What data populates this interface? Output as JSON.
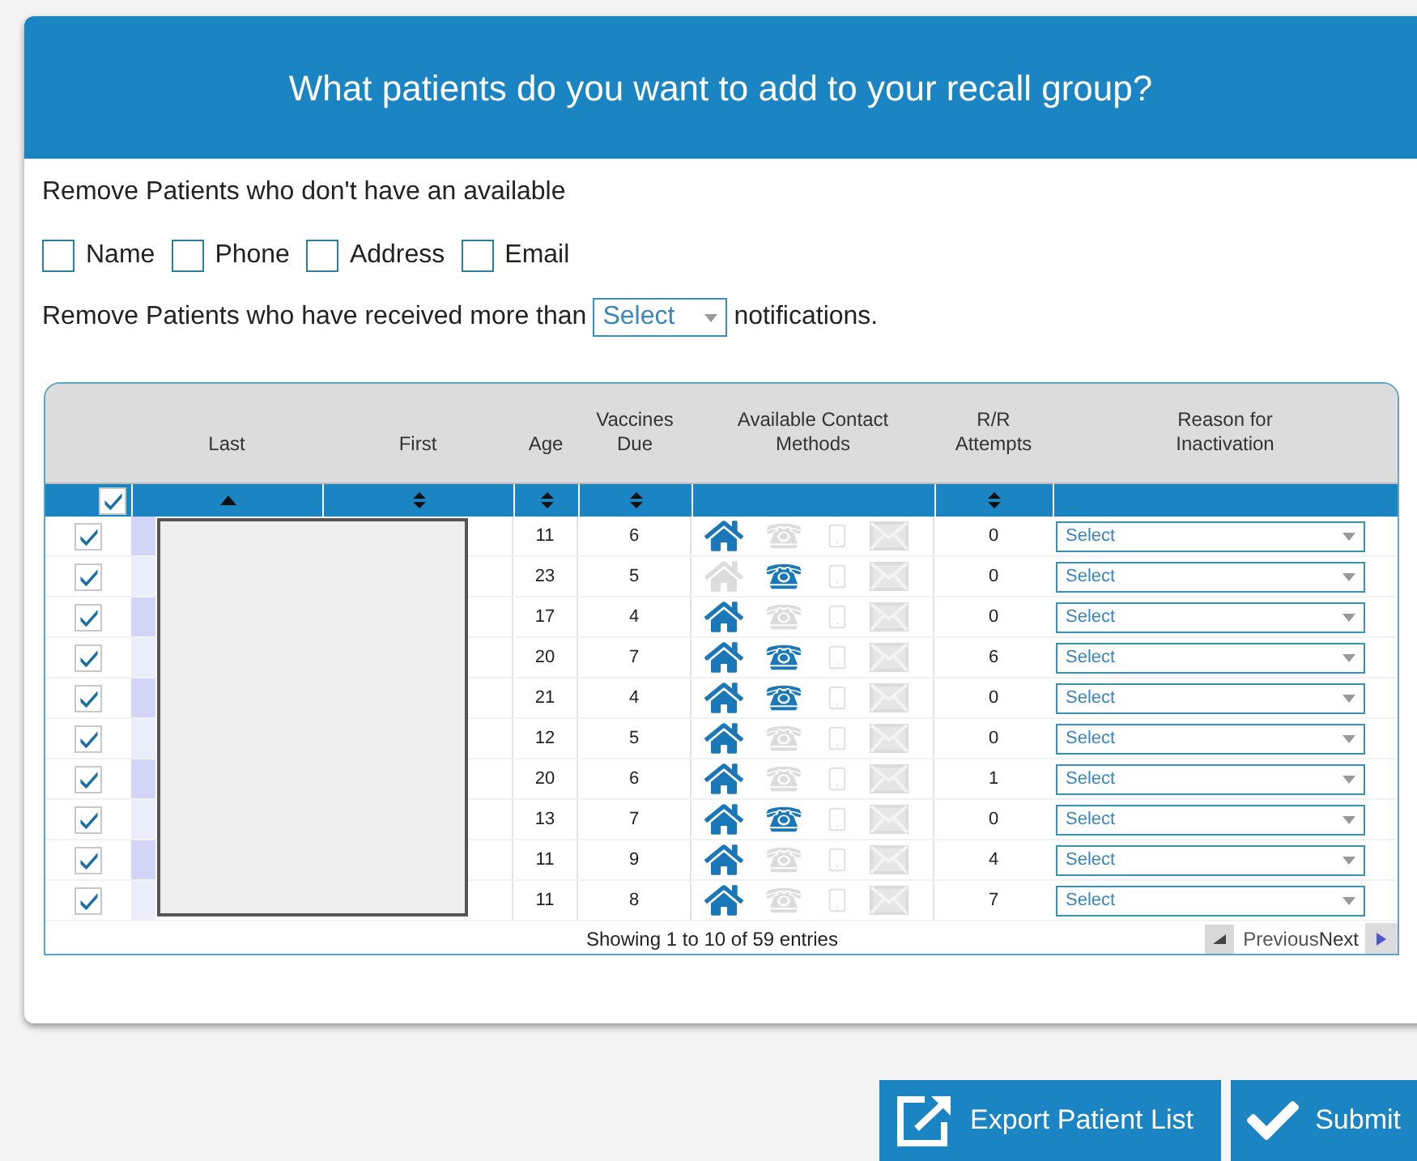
{
  "header": {
    "title": "What patients do you want to add to your recall group?"
  },
  "filters": {
    "intro": "Remove Patients who don't have an available",
    "options": [
      {
        "label": "Name",
        "checked": false
      },
      {
        "label": "Phone",
        "checked": false
      },
      {
        "label": "Address",
        "checked": false
      },
      {
        "label": "Email",
        "checked": false
      }
    ],
    "notifications": {
      "before": "Remove Patients who have received more than",
      "select": "Select",
      "after": "notifications."
    }
  },
  "table": {
    "columns": [
      {
        "label": "Last",
        "sortable": true,
        "sorted_ascending": true
      },
      {
        "label": "First",
        "sortable": true
      },
      {
        "label": "Age",
        "sortable": true
      },
      {
        "label": "Vaccines Due",
        "sortable": true
      },
      {
        "label": "Available Contact Methods",
        "sortable": false
      },
      {
        "label": "R/R Attempts",
        "sortable": true
      },
      {
        "label": "Reason for Inactivation",
        "sortable": false
      }
    ],
    "select_all": {
      "checked": true
    },
    "rows": [
      {
        "checked": true,
        "age": "11",
        "vaccines_due": "6",
        "home": true,
        "phone": false,
        "mobile": false,
        "email": false,
        "attempts": "0",
        "reason": "Select"
      },
      {
        "checked": true,
        "age": "23",
        "vaccines_due": "5",
        "home": false,
        "phone": true,
        "mobile": false,
        "email": false,
        "attempts": "0",
        "reason": "Select"
      },
      {
        "checked": true,
        "age": "17",
        "vaccines_due": "4",
        "home": true,
        "phone": false,
        "mobile": false,
        "email": false,
        "attempts": "0",
        "reason": "Select"
      },
      {
        "checked": true,
        "age": "20",
        "vaccines_due": "7",
        "home": true,
        "phone": true,
        "mobile": false,
        "email": false,
        "attempts": "6",
        "reason": "Select"
      },
      {
        "checked": true,
        "age": "21",
        "vaccines_due": "4",
        "home": true,
        "phone": true,
        "mobile": false,
        "email": false,
        "attempts": "0",
        "reason": "Select"
      },
      {
        "checked": true,
        "age": "12",
        "vaccines_due": "5",
        "home": true,
        "phone": false,
        "mobile": false,
        "email": false,
        "attempts": "0",
        "reason": "Select"
      },
      {
        "checked": true,
        "age": "20",
        "vaccines_due": "6",
        "home": true,
        "phone": false,
        "mobile": false,
        "email": false,
        "attempts": "1",
        "reason": "Select"
      },
      {
        "checked": true,
        "age": "13",
        "vaccines_due": "7",
        "home": true,
        "phone": true,
        "mobile": false,
        "email": false,
        "attempts": "0",
        "reason": "Select"
      },
      {
        "checked": true,
        "age": "11",
        "vaccines_due": "9",
        "home": true,
        "phone": false,
        "mobile": false,
        "email": false,
        "attempts": "4",
        "reason": "Select"
      },
      {
        "checked": true,
        "age": "11",
        "vaccines_due": "8",
        "home": true,
        "phone": false,
        "mobile": false,
        "email": false,
        "attempts": "7",
        "reason": "Select"
      }
    ],
    "info": "Showing 1 to 10 of 59 entries",
    "previous": {
      "label": "Previous",
      "disabled": true
    },
    "next": {
      "label": "Next",
      "disabled": false
    }
  },
  "actions": [
    {
      "kind": "export",
      "label": "Export Patient List"
    },
    {
      "kind": "submit",
      "label": "Submit"
    }
  ]
}
